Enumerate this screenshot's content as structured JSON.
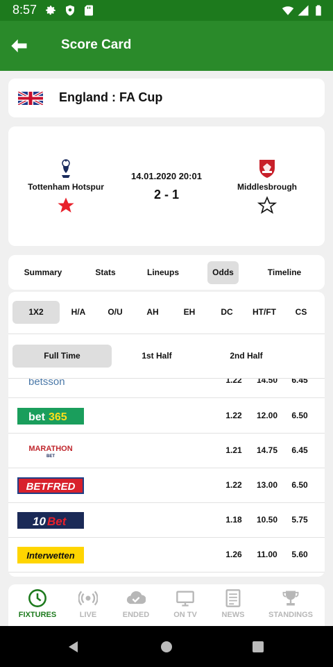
{
  "status_bar": {
    "time": "8:57"
  },
  "app_bar": {
    "title": "Score Card"
  },
  "competition": {
    "label": "England : FA Cup"
  },
  "match": {
    "home_team": "Tottenham Hotspur",
    "away_team": "Middlesbrough",
    "datetime": "14.01.2020 20:01",
    "score": "2 - 1",
    "home_favorite": true,
    "away_favorite": false
  },
  "tabs": [
    {
      "label": "Summary",
      "active": false
    },
    {
      "label": "Stats",
      "active": false
    },
    {
      "label": "Lineups",
      "active": false
    },
    {
      "label": "Odds",
      "active": true
    },
    {
      "label": "Timeline",
      "active": false
    }
  ],
  "markets": [
    {
      "label": "1X2",
      "active": true
    },
    {
      "label": "H/A",
      "active": false
    },
    {
      "label": "O/U",
      "active": false
    },
    {
      "label": "AH",
      "active": false
    },
    {
      "label": "EH",
      "active": false
    },
    {
      "label": "DC",
      "active": false
    },
    {
      "label": "HT/FT",
      "active": false
    },
    {
      "label": "CS",
      "active": false
    }
  ],
  "periods": [
    {
      "label": "Full Time",
      "active": true
    },
    {
      "label": "1st Half",
      "active": false
    },
    {
      "label": "2nd Half",
      "active": false
    }
  ],
  "bookmakers": [
    {
      "name": "betsson",
      "odds": [
        "1.22",
        "14.50",
        "6.45"
      ]
    },
    {
      "name": "bet365",
      "odds": [
        "1.22",
        "12.00",
        "6.50"
      ]
    },
    {
      "name": "MARATHON BET",
      "odds": [
        "1.21",
        "14.75",
        "6.45"
      ]
    },
    {
      "name": "BETFRED",
      "odds": [
        "1.22",
        "13.00",
        "6.50"
      ]
    },
    {
      "name": "10Bet",
      "odds": [
        "1.18",
        "10.50",
        "5.75"
      ]
    },
    {
      "name": "Interwetten",
      "odds": [
        "1.26",
        "11.00",
        "5.60"
      ]
    }
  ],
  "bottom_nav": [
    {
      "label": "FIXTURES",
      "icon": "clock-icon",
      "active": true
    },
    {
      "label": "LIVE",
      "icon": "live-broadcast-icon",
      "active": false
    },
    {
      "label": "ENDED",
      "icon": "cloud-check-icon",
      "active": false
    },
    {
      "label": "ON TV",
      "icon": "tv-icon",
      "active": false
    },
    {
      "label": "NEWS",
      "icon": "newspaper-icon",
      "active": false
    },
    {
      "label": "STANDINGS",
      "icon": "trophy-icon",
      "active": false
    }
  ],
  "colors": {
    "primary": "#2a8a2a",
    "status_bar": "#1d7a1d",
    "favorite_star": "#e8202a",
    "active_tab_bg": "#dedede"
  }
}
